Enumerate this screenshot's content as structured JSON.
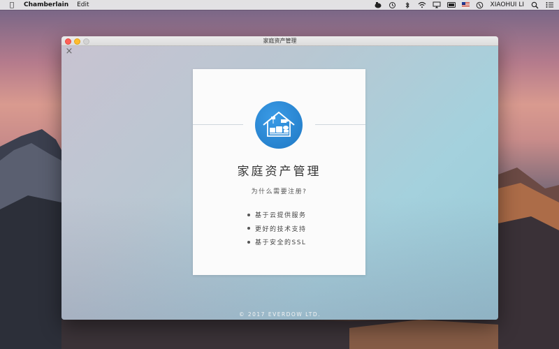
{
  "menubar": {
    "app_name": "Chamberlain",
    "menus": [
      "Edit"
    ],
    "user_name": "XIAOHUI LI",
    "status_icons": [
      "evernote-icon",
      "time-machine-icon",
      "bluetooth-icon",
      "wifi-icon",
      "airplay-icon",
      "battery-icon",
      "us-flag-icon",
      "clock-icon",
      "spotlight-icon",
      "notification-center-icon"
    ]
  },
  "window": {
    "title": "家庭资产管理"
  },
  "card": {
    "title": "家庭资产管理",
    "subtitle": "为什么需要注册?",
    "features": [
      "基于云提供服务",
      "更好的技术支持",
      "基于安全的SSL"
    ]
  },
  "footer": {
    "copyright": "© 2017 EVERDOW LTD."
  },
  "colors": {
    "logo_blue": "#2387d6",
    "traffic_close": "#ff5f57",
    "traffic_minimize": "#febc2e"
  }
}
